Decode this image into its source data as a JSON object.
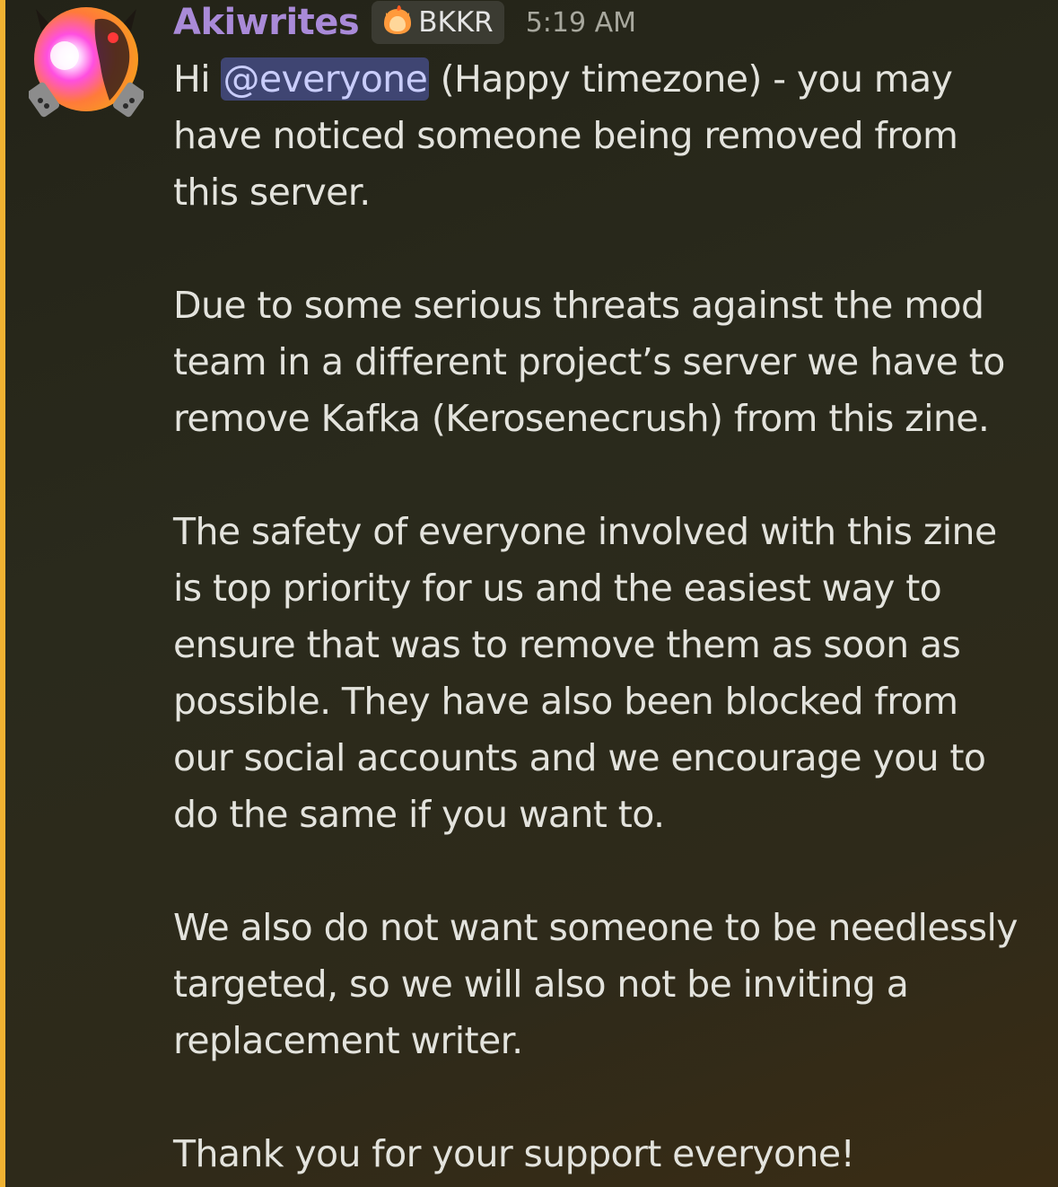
{
  "message": {
    "author": "Akiwrites",
    "tag": {
      "label": "BKKR",
      "icon": "flame-cat-icon"
    },
    "timestamp": "5:19 AM",
    "mention": "@everyone",
    "lines": {
      "p1_l1_pre": "Hi ",
      "p1_l1_post": " (Happy timezone) - you may",
      "p1_l2": "have noticed someone being removed from",
      "p1_l3": "this server.",
      "p2_l1": "Due to some serious threats against the mod",
      "p2_l2": "team in a different project’s server we have to",
      "p2_l3": "remove Kafka (Kerosenecrush) from this zine.",
      "p3_l1": "The safety of everyone involved with this zine",
      "p3_l2": "is top priority for us and the easiest way to",
      "p3_l3": "ensure that was to remove them as soon as",
      "p3_l4": "possible. They have also been blocked from",
      "p3_l5": "our social accounts and we encourage you to",
      "p3_l6": "do the same if you want to.",
      "p4_l1": "We also do not want someone to be needlessly",
      "p4_l2": "targeted, so we will also not be inviting a",
      "p4_l3": "replacement writer.",
      "p5_l1": "Thank you for your support everyone!"
    }
  },
  "colors": {
    "accent": "#f0b232",
    "username": "#a98ad8",
    "mention_bg": "#3f4572",
    "mention_text": "#c9cdfb",
    "body_text": "#e3e3dd"
  }
}
